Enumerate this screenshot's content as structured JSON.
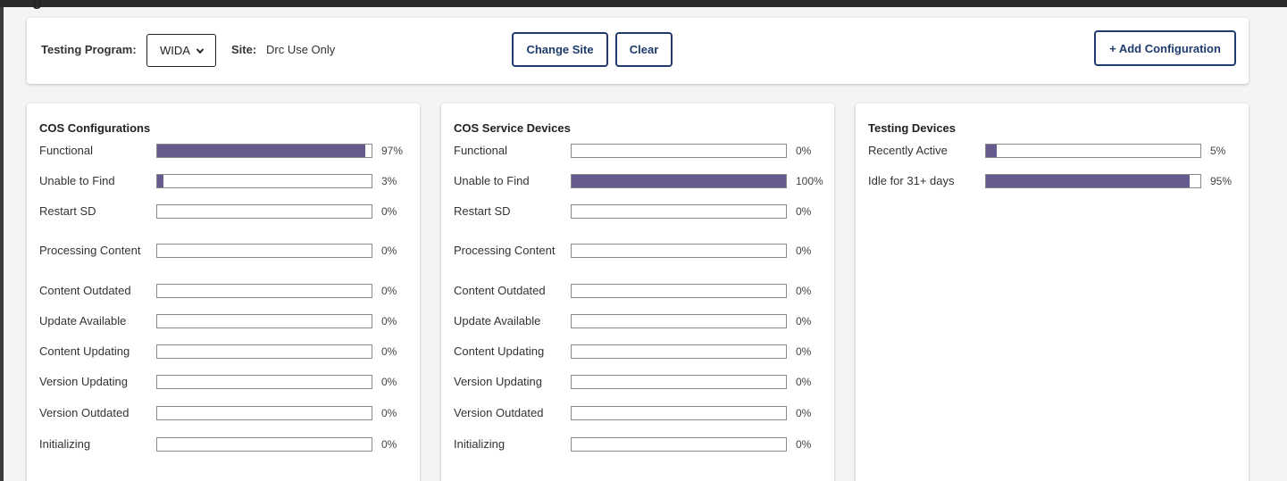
{
  "page": {
    "partial_title": "g"
  },
  "toolbar": {
    "program_label": "Testing Program:",
    "program_value": "WIDA",
    "site_label": "Site:",
    "site_value": "Drc Use Only",
    "change_site_label": "Change Site",
    "clear_label": "Clear",
    "add_config_label": "+ Add Configuration"
  },
  "colors": {
    "bar_fill": "#665a8f",
    "button_border": "#1f3b6e"
  },
  "cards": [
    {
      "title": "COS Configurations",
      "rows": [
        {
          "label": "Functional",
          "value": 0.97,
          "pct": "97%"
        },
        {
          "label": "Unable to Find",
          "value": 0.03,
          "pct": "3%"
        },
        {
          "label": "Restart SD",
          "value": 0,
          "pct": "0%"
        },
        {
          "label": "Processing Content",
          "value": 0,
          "pct": "0%"
        },
        {
          "label": "Content Outdated",
          "value": 0,
          "pct": "0%"
        },
        {
          "label": "Update Available",
          "value": 0,
          "pct": "0%"
        },
        {
          "label": "Content Updating",
          "value": 0,
          "pct": "0%"
        },
        {
          "label": "Version Updating",
          "value": 0,
          "pct": "0%"
        },
        {
          "label": "Version Outdated",
          "value": 0,
          "pct": "0%"
        },
        {
          "label": "Initializing",
          "value": 0,
          "pct": "0%"
        }
      ]
    },
    {
      "title": "COS Service Devices",
      "rows": [
        {
          "label": "Functional",
          "value": 0,
          "pct": "0%"
        },
        {
          "label": "Unable to Find",
          "value": 1,
          "pct": "100%"
        },
        {
          "label": "Restart SD",
          "value": 0,
          "pct": "0%"
        },
        {
          "label": "Processing Content",
          "value": 0,
          "pct": "0%"
        },
        {
          "label": "Content Outdated",
          "value": 0,
          "pct": "0%"
        },
        {
          "label": "Update Available",
          "value": 0,
          "pct": "0%"
        },
        {
          "label": "Content Updating",
          "value": 0,
          "pct": "0%"
        },
        {
          "label": "Version Updating",
          "value": 0,
          "pct": "0%"
        },
        {
          "label": "Version Outdated",
          "value": 0,
          "pct": "0%"
        },
        {
          "label": "Initializing",
          "value": 0,
          "pct": "0%"
        }
      ]
    },
    {
      "title": "Testing Devices",
      "rows": [
        {
          "label": "Recently Active",
          "value": 0.05,
          "pct": "5%"
        },
        {
          "label": "Idle for 31+ days",
          "value": 0.95,
          "pct": "95%"
        }
      ]
    }
  ]
}
